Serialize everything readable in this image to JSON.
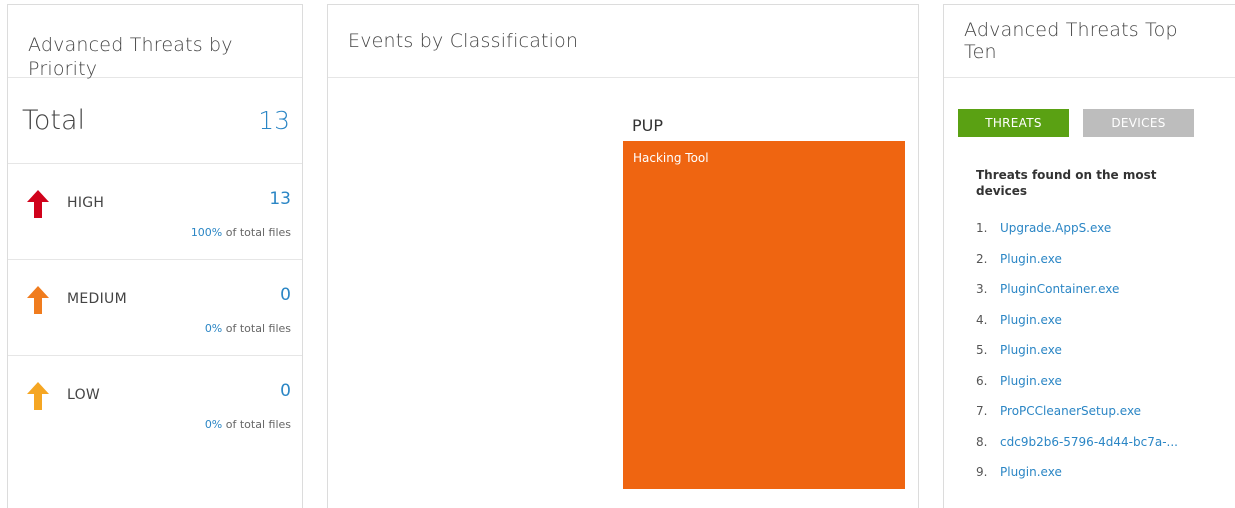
{
  "priority_panel": {
    "title": "Advanced Threats by Priority",
    "total_label": "Total",
    "total_value": "13",
    "rows": [
      {
        "label": "HIGH",
        "count": "13",
        "pct": "100%",
        "pct_suffix": " of total files",
        "color": "#d0021b"
      },
      {
        "label": "MEDIUM",
        "count": "0",
        "pct": "0%",
        "pct_suffix": " of total files",
        "color": "#f07c1e"
      },
      {
        "label": "LOW",
        "count": "0",
        "pct": "0%",
        "pct_suffix": " of total files",
        "color": "#f5a623"
      }
    ]
  },
  "classification_panel": {
    "title": "Events by Classification",
    "category": "PUP",
    "tile_label": "Hacking Tool",
    "tile_color": "#ef6511"
  },
  "top_ten_panel": {
    "title": "Advanced Threats Top Ten",
    "tab_threats": "THREATS",
    "tab_devices": "DEVICES",
    "list_title": "Threats found on the most devices",
    "items": [
      {
        "num": "1.",
        "name": "Upgrade.AppS.exe"
      },
      {
        "num": "2.",
        "name": "Plugin.exe"
      },
      {
        "num": "3.",
        "name": "PluginContainer.exe"
      },
      {
        "num": "4.",
        "name": "Plugin.exe"
      },
      {
        "num": "5.",
        "name": "Plugin.exe"
      },
      {
        "num": "6.",
        "name": "Plugin.exe"
      },
      {
        "num": "7.",
        "name": "ProPCCleanerSetup.exe"
      },
      {
        "num": "8.",
        "name": "cdc9b2b6-5796-4d44-bc7a-..."
      },
      {
        "num": "9.",
        "name": "Plugin.exe"
      }
    ]
  }
}
